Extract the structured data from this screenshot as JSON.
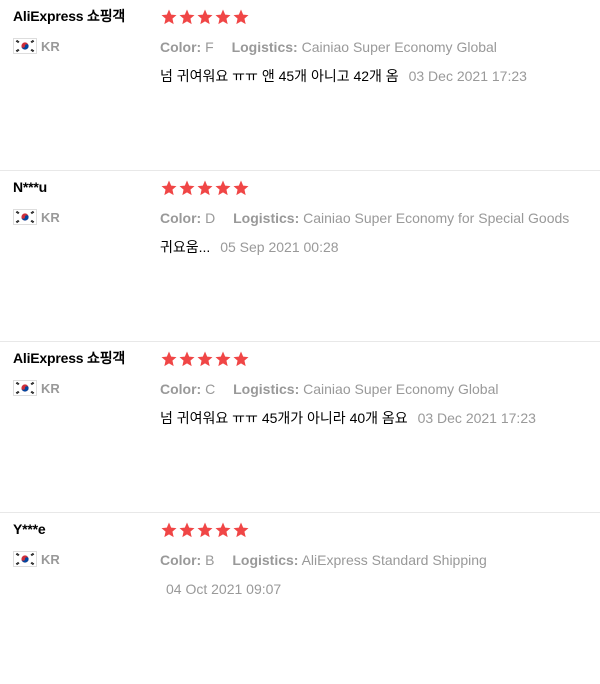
{
  "colors": {
    "star": "#f04646",
    "muted": "#999999",
    "divider": "#e8e8e8"
  },
  "icons": {
    "flag": "kr-flag-icon",
    "star": "star-icon"
  },
  "labels": {
    "color": "Color:",
    "logistics": "Logistics:"
  },
  "reviews": [
    {
      "user": "AliExpress 쇼핑객",
      "country": "KR",
      "rating": 5,
      "color": "F",
      "logistics": "Cainiao Super Economy Global",
      "text": "넘 귀여워요 ㅠㅠ 앤 45개 아니고 42개 옴",
      "date": "03 Dec 2021 17:23"
    },
    {
      "user": "N***u",
      "country": "KR",
      "rating": 5,
      "color": "D",
      "logistics": "Cainiao Super Economy for Special Goods",
      "text": "귀요움...",
      "date": "05 Sep 2021 00:28"
    },
    {
      "user": "AliExpress 쇼핑객",
      "country": "KR",
      "rating": 5,
      "color": "C",
      "logistics": "Cainiao Super Economy Global",
      "text": "넘 귀여워요 ㅠㅠ 45개가 아니라 40개 옴요",
      "date": "03 Dec 2021 17:23"
    },
    {
      "user": "Y***e",
      "country": "KR",
      "rating": 5,
      "color": "B",
      "logistics": "AliExpress Standard Shipping",
      "text": "",
      "date": "04 Oct 2021 09:07"
    }
  ]
}
